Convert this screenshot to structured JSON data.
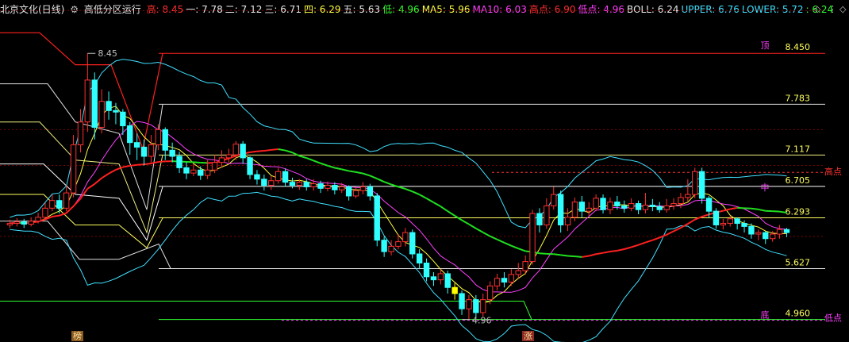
{
  "header": {
    "stock_name": "北京文化(日线)",
    "indicator_name": "高低分区运行",
    "items": [
      {
        "label": "高:",
        "value": "8.45",
        "color": "#ff3030"
      },
      {
        "label": "一:",
        "value": "7.78",
        "color": "#e8e8e8"
      },
      {
        "label": "二:",
        "value": "7.12",
        "color": "#e8e8e8"
      },
      {
        "label": "三:",
        "value": "6.71",
        "color": "#e8e8e8"
      },
      {
        "label": "四:",
        "value": "6.29",
        "color": "#ffff40"
      },
      {
        "label": "五:",
        "value": "5.63",
        "color": "#e8e8e8"
      },
      {
        "label": "低:",
        "value": "4.96",
        "color": "#30ff30"
      },
      {
        "label": "MA5:",
        "value": "5.96",
        "color": "#ffff40"
      },
      {
        "label": "MA10:",
        "value": "6.03",
        "color": "#ff40ff"
      },
      {
        "label": "高点:",
        "value": "6.90",
        "color": "#ff3030"
      },
      {
        "label": "低点:",
        "value": "4.96",
        "color": "#ff40ff"
      },
      {
        "label": "BOLL:",
        "value": "6.24",
        "color": "#e8e8e8"
      },
      {
        "label": "UPPER:",
        "value": "6.76",
        "color": "#40e0ff"
      },
      {
        "label": "LOWER:",
        "value": "5.72",
        "color": "#40e0ff"
      },
      {
        "label": ":",
        "value": "6.24",
        "color": "#30ff30"
      }
    ],
    "controls": {
      "up": "◇",
      "menu": "⋮",
      "down": "◇"
    }
  },
  "colors": {
    "up": "#ff3030",
    "down": "#30ffff",
    "highlight": "#ffff00",
    "grid": "#800000"
  },
  "tags": {
    "bottom_left": "榜",
    "bottom_mid": "涨"
  },
  "annotations": {
    "top": "顶",
    "middle": "中",
    "bottom": "底",
    "high_point": "高点",
    "low_point": "低点"
  },
  "chart_data": {
    "type": "candlestick",
    "ylim": [
      4.8,
      8.9
    ],
    "levels": [
      {
        "name": "高",
        "value": 8.45,
        "label": "8.450",
        "color": "#ff2020"
      },
      {
        "name": "一",
        "value": 7.783,
        "label": "7.783",
        "color": "#e0e0e0"
      },
      {
        "name": "二",
        "value": 7.117,
        "label": "7.117",
        "color": "#f0f080"
      },
      {
        "name": "三",
        "value": 6.705,
        "label": "6.705",
        "color": "#ffffff"
      },
      {
        "name": "四",
        "value": 6.293,
        "label": "6.293",
        "color": "#ffff60"
      },
      {
        "name": "五",
        "value": 5.627,
        "label": "5.627",
        "color": "#e0e0e0"
      },
      {
        "name": "低",
        "value": 4.96,
        "label": "4.960",
        "color": "#30ff30"
      }
    ],
    "high_point_value": 6.9,
    "low_point_value": 4.96,
    "price_labels": [
      {
        "index": 11,
        "value": 8.45,
        "text": "8.45"
      },
      {
        "index": 64,
        "value": 4.96,
        "text": "4.96"
      }
    ],
    "candles": [
      [
        6.2,
        6.22,
        6.27,
        6.16
      ],
      [
        6.22,
        6.24,
        6.29,
        6.18
      ],
      [
        6.24,
        6.21,
        6.28,
        6.16
      ],
      [
        6.21,
        6.25,
        6.3,
        6.18
      ],
      [
        6.25,
        6.3,
        6.36,
        6.22
      ],
      [
        6.3,
        6.42,
        6.49,
        6.27
      ],
      [
        6.42,
        6.52,
        6.6,
        6.38
      ],
      [
        6.52,
        6.42,
        6.6,
        6.35
      ],
      [
        6.42,
        6.62,
        6.72,
        6.38
      ],
      [
        6.62,
        7.25,
        7.38,
        6.56
      ],
      [
        7.25,
        7.55,
        7.72,
        7.15
      ],
      [
        7.55,
        8.1,
        8.45,
        7.42
      ],
      [
        8.1,
        7.48,
        8.2,
        7.32
      ],
      [
        7.48,
        7.82,
        7.98,
        7.4
      ],
      [
        7.82,
        7.7,
        7.95,
        7.58
      ],
      [
        7.7,
        7.68,
        7.8,
        7.52
      ],
      [
        7.68,
        7.5,
        7.72,
        7.38
      ],
      [
        7.5,
        7.28,
        7.55,
        7.12
      ],
      [
        7.28,
        7.22,
        7.4,
        7.05
      ],
      [
        7.22,
        7.1,
        7.32,
        6.98
      ],
      [
        7.1,
        7.25,
        7.38,
        7.02
      ],
      [
        7.25,
        7.45,
        7.52,
        7.18
      ],
      [
        7.45,
        7.18,
        7.48,
        7.05
      ],
      [
        7.18,
        7.1,
        7.28,
        7.02
      ],
      [
        7.1,
        6.95,
        7.16,
        6.88
      ],
      [
        6.95,
        6.88,
        7.02,
        6.8
      ],
      [
        6.88,
        6.92,
        7.0,
        6.84
      ],
      [
        6.92,
        6.85,
        6.97,
        6.79
      ],
      [
        6.85,
        6.92,
        7.05,
        6.8
      ],
      [
        6.92,
        7.02,
        7.12,
        6.88
      ],
      [
        7.02,
        7.08,
        7.18,
        6.95
      ],
      [
        7.08,
        7.12,
        7.2,
        7.02
      ],
      [
        7.12,
        7.26,
        7.3,
        7.05
      ],
      [
        7.26,
        7.08,
        7.3,
        7.0
      ],
      [
        7.08,
        6.86,
        7.1,
        6.8
      ],
      [
        6.86,
        6.8,
        6.92,
        6.73
      ],
      [
        6.8,
        6.72,
        6.86,
        6.65
      ],
      [
        6.72,
        6.78,
        6.84,
        6.66
      ],
      [
        6.78,
        6.9,
        6.95,
        6.74
      ],
      [
        6.9,
        6.76,
        6.94,
        6.7
      ],
      [
        6.76,
        6.72,
        6.82,
        6.68
      ],
      [
        6.72,
        6.76,
        6.8,
        6.66
      ],
      [
        6.76,
        6.7,
        6.8,
        6.65
      ],
      [
        6.7,
        6.74,
        6.8,
        6.65
      ],
      [
        6.74,
        6.68,
        6.78,
        6.62
      ],
      [
        6.68,
        6.72,
        6.77,
        6.64
      ],
      [
        6.72,
        6.66,
        6.76,
        6.6
      ],
      [
        6.66,
        6.7,
        6.75,
        6.62
      ],
      [
        6.7,
        6.58,
        6.72,
        6.52
      ],
      [
        6.58,
        6.65,
        6.7,
        6.55
      ],
      [
        6.65,
        6.7,
        6.76,
        6.6
      ],
      [
        6.7,
        6.58,
        6.74,
        6.52
      ],
      [
        6.58,
        6.0,
        6.62,
        5.92
      ],
      [
        6.0,
        5.85,
        6.05,
        5.78
      ],
      [
        5.85,
        5.92,
        6.0,
        5.8
      ],
      [
        5.92,
        5.98,
        6.08,
        5.88
      ],
      [
        5.98,
        6.1,
        6.16,
        5.92
      ],
      [
        6.1,
        5.82,
        6.14,
        5.76
      ],
      [
        5.82,
        5.7,
        5.88,
        5.62
      ],
      [
        5.7,
        5.52,
        5.76,
        5.46
      ],
      [
        5.52,
        5.48,
        5.58,
        5.4
      ],
      [
        5.48,
        5.56,
        5.62,
        5.42
      ],
      [
        5.56,
        5.38,
        5.6,
        5.3
      ],
      [
        5.38,
        5.3,
        5.44,
        5.22
      ],
      [
        5.3,
        5.1,
        5.34,
        5.02
      ],
      [
        5.1,
        5.22,
        5.28,
        4.96
      ],
      [
        5.22,
        5.05,
        5.28,
        4.98
      ],
      [
        5.05,
        5.22,
        5.3,
        5.0
      ],
      [
        5.22,
        5.4,
        5.46,
        5.16
      ],
      [
        5.4,
        5.5,
        5.56,
        5.34
      ],
      [
        5.5,
        5.45,
        5.58,
        5.38
      ],
      [
        5.45,
        5.55,
        5.62,
        5.4
      ],
      [
        5.55,
        5.6,
        5.7,
        5.5
      ],
      [
        5.6,
        5.72,
        5.8,
        5.55
      ],
      [
        5.72,
        6.35,
        6.4,
        5.68
      ],
      [
        6.35,
        6.2,
        6.42,
        6.1
      ],
      [
        6.2,
        6.45,
        6.55,
        6.15
      ],
      [
        6.45,
        6.6,
        6.7,
        6.4
      ],
      [
        6.6,
        6.2,
        6.65,
        6.1
      ],
      [
        6.2,
        6.3,
        6.42,
        6.12
      ],
      [
        6.3,
        6.5,
        6.56,
        6.25
      ],
      [
        6.5,
        6.38,
        6.58,
        6.3
      ],
      [
        6.38,
        6.42,
        6.5,
        6.32
      ],
      [
        6.42,
        6.55,
        6.6,
        6.38
      ],
      [
        6.55,
        6.4,
        6.6,
        6.35
      ],
      [
        6.4,
        6.5,
        6.56,
        6.34
      ],
      [
        6.5,
        6.45,
        6.58,
        6.4
      ],
      [
        6.45,
        6.42,
        6.52,
        6.36
      ],
      [
        6.42,
        6.48,
        6.55,
        6.38
      ],
      [
        6.48,
        6.4,
        6.52,
        6.34
      ],
      [
        6.4,
        6.46,
        6.62,
        6.35
      ],
      [
        6.46,
        6.44,
        6.54,
        6.38
      ],
      [
        6.44,
        6.4,
        6.5,
        6.36
      ],
      [
        6.4,
        6.45,
        6.54,
        6.36
      ],
      [
        6.45,
        6.48,
        6.55,
        6.4
      ],
      [
        6.48,
        6.56,
        6.62,
        6.42
      ],
      [
        6.56,
        6.6,
        6.8,
        6.5
      ],
      [
        6.6,
        6.9,
        6.95,
        6.55
      ],
      [
        6.9,
        6.55,
        6.95,
        6.48
      ],
      [
        6.55,
        6.38,
        6.58,
        6.3
      ],
      [
        6.38,
        6.2,
        6.42,
        6.15
      ],
      [
        6.2,
        6.22,
        6.28,
        6.14
      ],
      [
        6.22,
        6.28,
        6.32,
        6.18
      ],
      [
        6.28,
        6.22,
        6.3,
        6.14
      ],
      [
        6.22,
        6.18,
        6.26,
        6.1
      ],
      [
        6.18,
        6.08,
        6.22,
        6.02
      ],
      [
        6.08,
        6.1,
        6.14,
        6.0
      ],
      [
        6.1,
        6.02,
        6.12,
        5.95
      ],
      [
        6.02,
        6.08,
        6.12,
        5.98
      ],
      [
        6.08,
        6.14,
        6.2,
        6.02
      ],
      [
        6.14,
        6.1,
        6.16,
        6.04
      ]
    ]
  }
}
